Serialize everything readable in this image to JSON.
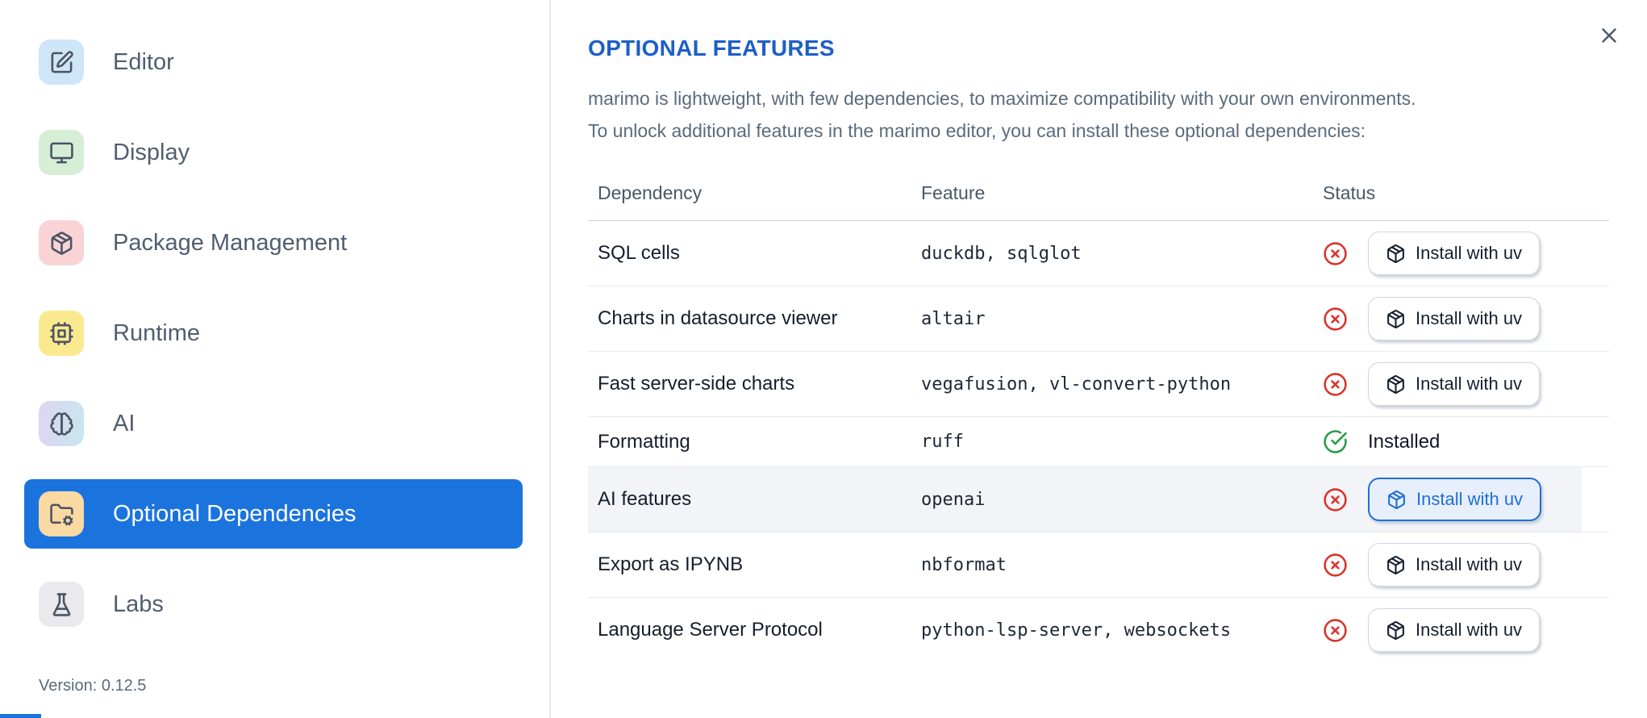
{
  "sidebar": {
    "items": [
      {
        "label": "Editor",
        "icon": "square-pen-icon",
        "tile_color": "#cfe5f8",
        "selected": false
      },
      {
        "label": "Display",
        "icon": "monitor-icon",
        "tile_color": "#d5eed6",
        "selected": false
      },
      {
        "label": "Package Management",
        "icon": "package-icon",
        "tile_color": "#f9d3d6",
        "selected": false
      },
      {
        "label": "Runtime",
        "icon": "cpu-icon",
        "tile_color": "#fbe98f",
        "selected": false
      },
      {
        "label": "AI",
        "icon": "brain-icon",
        "tile_color": "#ded5f2",
        "tile_color2": "#c7e7ee",
        "selected": false
      },
      {
        "label": "Optional Dependencies",
        "icon": "folder-cog-icon",
        "tile_color": "#fbd9a3",
        "selected": true
      },
      {
        "label": "Labs",
        "icon": "flask-icon",
        "tile_color": "#e9e9ee",
        "selected": false
      }
    ],
    "version_label": "Version: 0.12.5",
    "selected_color": "#1b74de"
  },
  "panel": {
    "title": "OPTIONAL FEATURES",
    "title_color": "#1d5fc8",
    "description_line1": "marimo is lightweight, with few dependencies, to maximize compatibility with your own environments.",
    "description_line2": "To unlock additional features in the marimo editor, you can install these optional dependencies:",
    "table": {
      "columns": [
        "Dependency",
        "Feature",
        "Status"
      ],
      "rows": [
        {
          "dependency": "SQL cells",
          "feature": "duckdb, sqlglot",
          "installed": false,
          "action_label": "Install with uv",
          "highlighted": false
        },
        {
          "dependency": "Charts in datasource viewer",
          "feature": "altair",
          "installed": false,
          "action_label": "Install with uv",
          "highlighted": false
        },
        {
          "dependency": "Fast server-side charts",
          "feature": "vegafusion, vl-convert-python",
          "installed": false,
          "action_label": "Install with uv",
          "highlighted": false
        },
        {
          "dependency": "Formatting",
          "feature": "ruff",
          "installed": true,
          "status_label": "Installed",
          "highlighted": false
        },
        {
          "dependency": "AI features",
          "feature": "openai",
          "installed": false,
          "action_label": "Install with uv",
          "highlighted": true
        },
        {
          "dependency": "Export as IPYNB",
          "feature": "nbformat",
          "installed": false,
          "action_label": "Install with uv",
          "highlighted": false
        },
        {
          "dependency": "Language Server Protocol",
          "feature": "python-lsp-server, websockets",
          "installed": false,
          "action_label": "Install with uv",
          "highlighted": false
        }
      ]
    },
    "status_colors": {
      "not_installed": "#d9342b",
      "installed": "#2b9c47",
      "highlight_button": "#1f6fd6"
    }
  }
}
